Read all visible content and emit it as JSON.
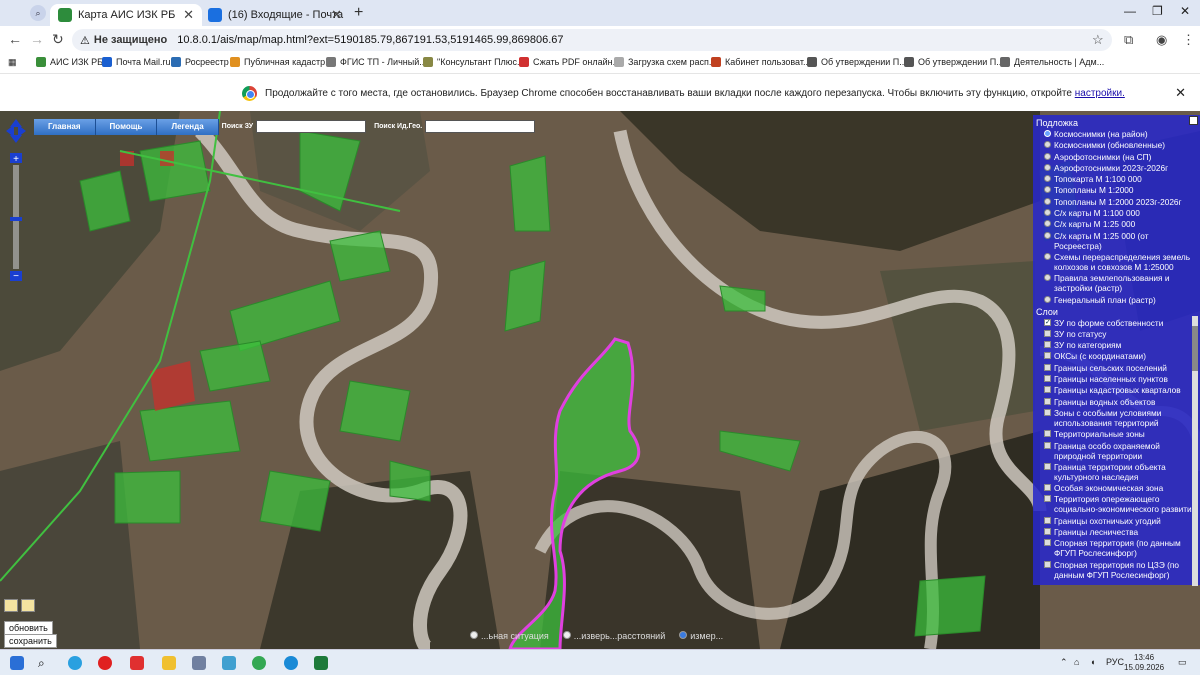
{
  "tabs": [
    {
      "label": "Карта АИС ИЗК РБ",
      "active": true
    },
    {
      "label": "(16) Входящие - Почта",
      "active": false
    }
  ],
  "address": {
    "security": "Не защищено",
    "url": "10.8.0.1/ais/map/map.html?ext=5190185.79,867191.53,5191465.99,869806.67"
  },
  "bookmarks": [
    "АИС ИЗК РБ",
    "Почта Mail.ru",
    "Росреестр",
    "Публичная кадастр...",
    "ФГИС ТП - Личный...",
    "\"Консультант Плюс...",
    "Сжать PDF онлайн...",
    "Загрузка схем расп...",
    "Кабинет пользоват...",
    "Об утверждении П...",
    "Об утверждении П...",
    "Деятельность | Адм..."
  ],
  "infobar": {
    "message": "Продолжайте с того места, где остановились. Браузер Chrome способен восстанавливать ваши вкладки после каждого перезапуска. Чтобы включить эту функцию, откройте",
    "link": "настройки."
  },
  "mapnav": {
    "home": "Главная",
    "help": "Помощь",
    "legend": "Легенда",
    "search_zu": "Поиск ЗУ",
    "search_id": "Поиск Ид.Гео."
  },
  "map_buttons": {
    "refresh": "обновить",
    "save": "сохранить"
  },
  "map_footer": [
    "...ьная ситуация",
    "...изверь...расстояний",
    "измер..."
  ],
  "panel": {
    "basemap_title": "Подложка",
    "basemaps": [
      {
        "label": "Космоснимки (на район)",
        "selected": true
      },
      {
        "label": "Космоснимки (обновленные)",
        "selected": false
      },
      {
        "label": "Аэрофотоснимки (на СП)",
        "selected": false
      },
      {
        "label": "Аэрофотоснимки 2023г-2026г",
        "selected": false
      },
      {
        "label": "Топокарта М 1:100 000",
        "selected": false
      },
      {
        "label": "Топопланы М 1:2000",
        "selected": false
      },
      {
        "label": "Топопланы М 1:2000 2023г-2026г",
        "selected": false
      },
      {
        "label": "С/х карты М 1:100 000",
        "selected": false
      },
      {
        "label": "С/х карты М 1:25 000",
        "selected": false
      },
      {
        "label": "С/х карты М 1:25 000 (от Росреестра)",
        "selected": false
      },
      {
        "label": "Схемы перераспределения земель колхозов и совхозов М 1:25000",
        "selected": false
      },
      {
        "label": "Правила землепользования и застройки (растр)",
        "selected": false
      },
      {
        "label": "Генеральный план (растр)",
        "selected": false
      }
    ],
    "layers_title": "Слои",
    "layers": [
      {
        "label": "ЗУ по форме собственности",
        "checked": true
      },
      {
        "label": "ЗУ по статусу",
        "checked": false
      },
      {
        "label": "ЗУ по категориям",
        "checked": false
      },
      {
        "label": "ОКСы (с координатами)",
        "checked": false
      },
      {
        "label": "Границы сельских поселений",
        "checked": false
      },
      {
        "label": "Границы населенных пунктов",
        "checked": false
      },
      {
        "label": "Границы кадастровых кварталов",
        "checked": false
      },
      {
        "label": "Границы водных объектов",
        "checked": false
      },
      {
        "label": "Зоны с особыми условиями использования территорий",
        "checked": false
      },
      {
        "label": "Территориальные зоны",
        "checked": false
      },
      {
        "label": "Граница особо охраняемой природной территории",
        "checked": false
      },
      {
        "label": "Граница территории объекта культурного наследия",
        "checked": false
      },
      {
        "label": "Особая экономическая зона",
        "checked": false
      },
      {
        "label": "Территория опережающего социально-экономического развития",
        "checked": false
      },
      {
        "label": "Границы охотничьих угодий",
        "checked": false
      },
      {
        "label": "Границы лесничества",
        "checked": false
      },
      {
        "label": "Спорная территория (по данным ФГУП Рослесинфорг)",
        "checked": false
      },
      {
        "label": "Спорная территория по ЦЗЭ (по данным ФГУП Рослесинфорг)",
        "checked": false
      }
    ]
  },
  "taskbar": {
    "lang": "РУС",
    "time": "13:46",
    "date": "15.09.2026"
  },
  "colors": {
    "parcel_green": "#3cbf3c",
    "parcel_red": "#c8302c",
    "selected_outline": "#e040e0",
    "panel_blue": "#2828c8",
    "river": "#cfc9c0"
  }
}
